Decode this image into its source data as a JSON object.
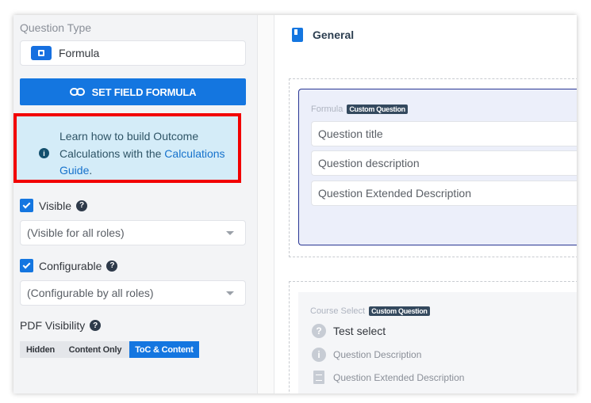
{
  "left": {
    "question_type_label": "Question Type",
    "question_type_value": "Formula",
    "formula_button_label": "SET FIELD FORMULA",
    "callout": {
      "text_before": "Learn how to build Outcome Calculations with the ",
      "link_text": "Calculations Guide",
      "text_after": "."
    },
    "visible": {
      "label": "Visible",
      "checked": true,
      "dropdown_value": "(Visible for all roles)"
    },
    "configurable": {
      "label": "Configurable",
      "checked": true,
      "dropdown_value": "(Configurable by all roles)"
    },
    "pdf_visibility": {
      "label": "PDF Visibility",
      "options": [
        "Hidden",
        "Content Only",
        "ToC & Content"
      ],
      "selected": "ToC & Content"
    }
  },
  "right": {
    "section_title": "General",
    "formula_card": {
      "type_label": "Formula",
      "badge": "Custom Question",
      "title_placeholder": "Question title",
      "description_placeholder": "Question description",
      "extended_placeholder": "Question Extended Description"
    },
    "course_card": {
      "type_label": "Course Select",
      "badge": "Custom Question",
      "title": "Test select",
      "description": "Question Description",
      "extended": "Question Extended Description"
    }
  },
  "colors": {
    "primary": "#1476e0",
    "callout_bg": "#d4ecf8",
    "highlight_border": "#f20000",
    "card_border": "#283593"
  }
}
